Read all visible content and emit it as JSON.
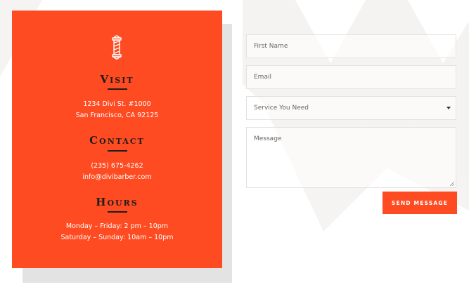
{
  "colors": {
    "accent": "#ff4b22",
    "heading": "#1d1d1d",
    "shadow": "#e3e3e3"
  },
  "contact_card": {
    "icon": "barber-pole-icon",
    "visit": {
      "heading": "Visit",
      "address_line1": "1234 Divi St. #1000",
      "address_line2": "San Francisco, CA 92125"
    },
    "contact": {
      "heading": "Contact",
      "phone": "(235) 675-4262",
      "email": "info@divibarber.com"
    },
    "hours": {
      "heading": "Hours",
      "weekdays": "Monday – Friday: 2 pm – 10pm",
      "weekend": "Saturday – Sunday: 10am – 10pm"
    }
  },
  "form": {
    "first_name_placeholder": "First Name",
    "email_placeholder": "Email",
    "service_placeholder": "Service You Need",
    "message_placeholder": "Message",
    "submit_label": "SEND MESSAGE"
  }
}
